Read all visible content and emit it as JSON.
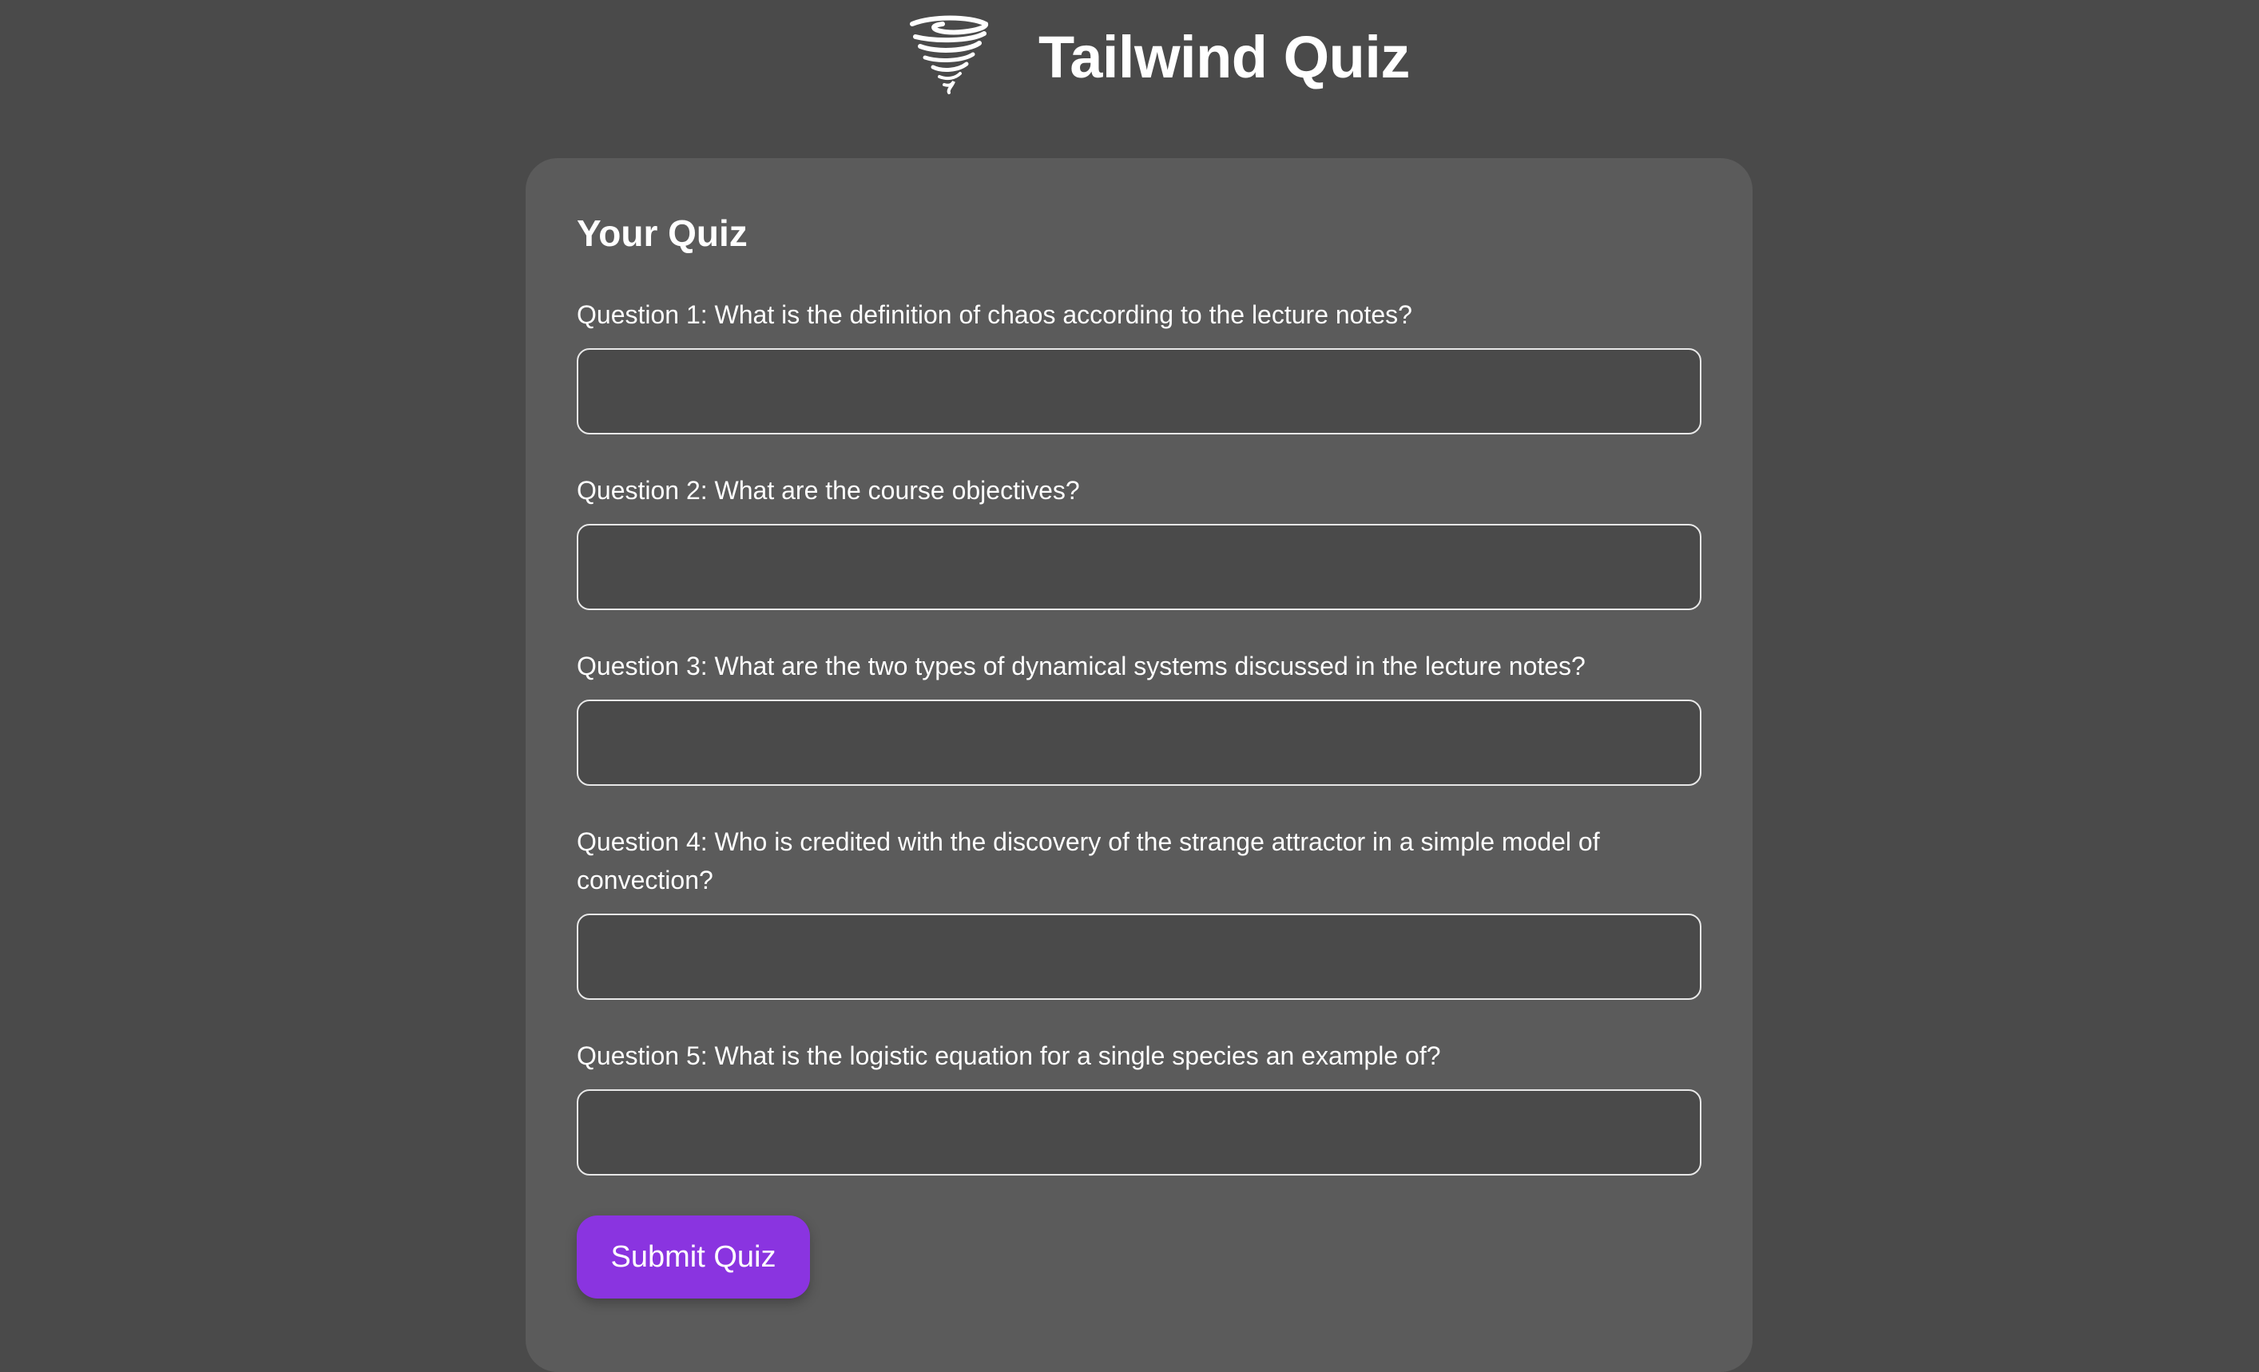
{
  "header": {
    "logo_icon": "tornado-icon",
    "title": "Tailwind Quiz"
  },
  "quiz": {
    "title": "Your Quiz",
    "questions": [
      {
        "label": "Question 1: What is the definition of chaos according to the lecture notes?",
        "value": "",
        "placeholder": ""
      },
      {
        "label": "Question 2: What are the course objectives?",
        "value": "",
        "placeholder": ""
      },
      {
        "label": "Question 3: What are the two types of dynamical systems discussed in the lecture notes?",
        "value": "",
        "placeholder": ""
      },
      {
        "label": "Question 4: Who is credited with the discovery of the strange attractor in a simple model of convection?",
        "value": "",
        "placeholder": ""
      },
      {
        "label": "Question 5: What is the logistic equation for a single species an example of?",
        "value": "",
        "placeholder": ""
      }
    ],
    "submit_label": "Submit Quiz"
  },
  "colors": {
    "page_background": "#4a4a4a",
    "card_background": "#5b5b5b",
    "input_background": "#4a4a4a",
    "input_border": "#e8e8e8",
    "accent": "#8a34e0",
    "text": "#ffffff"
  }
}
